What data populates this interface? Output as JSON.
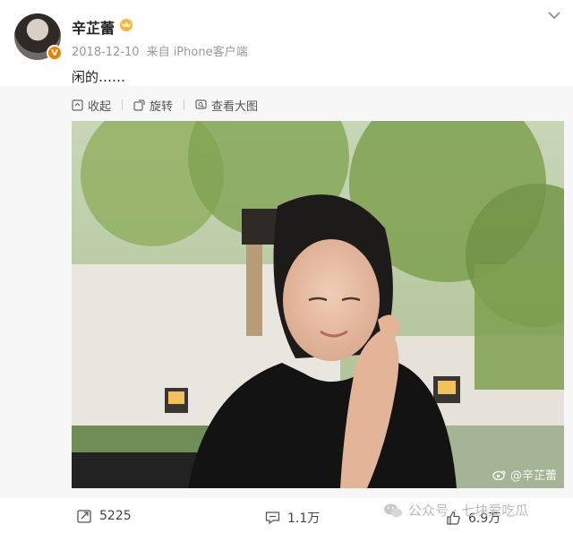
{
  "post": {
    "author": "辛芷蕾",
    "date": "2018-12-10",
    "source": "来自 iPhone客户端",
    "verified_badge": "V",
    "text": "闲的……"
  },
  "toolbar": {
    "collapse": "收起",
    "rotate": "旋转",
    "view_large": "查看大图"
  },
  "photo": {
    "watermark": "@辛芷蕾"
  },
  "actions": {
    "repost_count": "5225",
    "comment_count": "1.1万",
    "like_count": "6.9万"
  },
  "overlay": {
    "text": "公众号 · 七块爱吃瓜"
  },
  "colors": {
    "badge": "#f07c00",
    "background_gray": "#f7f7f7"
  }
}
